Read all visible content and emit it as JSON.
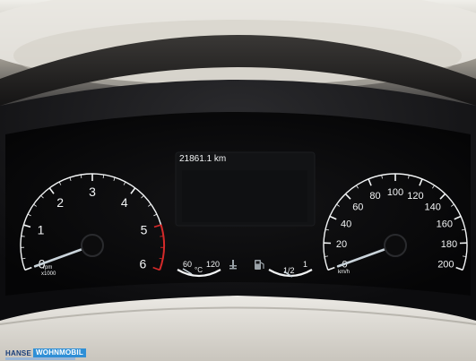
{
  "instrument_cluster": {
    "odometer": "21861.1 km",
    "tachometer": {
      "ticks": [
        "0",
        "1",
        "2",
        "3",
        "4",
        "5",
        "6"
      ],
      "unit_line1": "rpm",
      "unit_line2": "x1000",
      "redline_start": "5"
    },
    "speedometer": {
      "ticks": [
        "0",
        "20",
        "40",
        "60",
        "80",
        "100",
        "120",
        "140",
        "160",
        "180",
        "200"
      ],
      "unit": "km/h"
    },
    "coolant_gauge": {
      "low_label": "60",
      "high_label": "120",
      "unit": "°C"
    },
    "fuel_gauge": {
      "level_label": "1/2",
      "full_label": "1"
    },
    "needle_colors": {
      "needles": "#c9d3da",
      "redline": "#d52a2a",
      "markings": "#f2f4f5"
    }
  },
  "watermark": {
    "brand_part1": "HANSE",
    "brand_part2": "WOHNMOBIL"
  }
}
